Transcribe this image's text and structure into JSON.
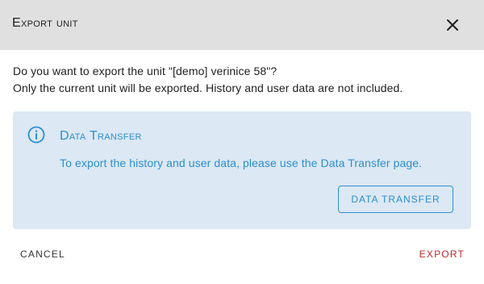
{
  "dialog": {
    "title": "Export unit",
    "close_icon": "close-icon"
  },
  "message": {
    "question": "Do you want to export the unit \"[demo] verinice 58\"?",
    "note": "Only the current unit will be exported. History and user data are not included."
  },
  "alert": {
    "icon": "info-icon",
    "title": "Data Transfer",
    "text": "To export the history and user data, please use the Data Transfer page.",
    "button_label": "DATA TRANSFER",
    "color": "#2a8fd0",
    "background": "#dce8f3"
  },
  "actions": {
    "cancel_label": "CANCEL",
    "export_label": "EXPORT",
    "export_color": "#c62828"
  }
}
